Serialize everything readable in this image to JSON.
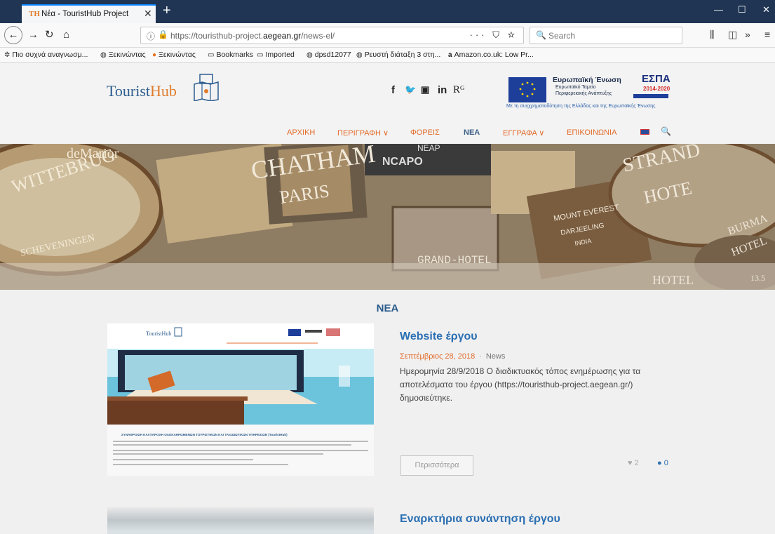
{
  "browser": {
    "tab_title": "Νέα - TouristHub Project",
    "tab_favicon": "TH",
    "url_prefix": "https://touristhub-project.",
    "url_domain": "aegean.gr",
    "url_path": "/news-el/",
    "search_placeholder": "Search"
  },
  "bookmarks": [
    {
      "label": "Πιο συχνά αναγνωσμ...",
      "icon": "gear-icon"
    },
    {
      "label": "Ξεκινώντας",
      "icon": "globe-icon"
    },
    {
      "label": "Ξεκινώντας",
      "icon": "firefox-icon"
    },
    {
      "label": "Bookmarks",
      "icon": "folder-icon"
    },
    {
      "label": "Imported",
      "icon": "folder-icon"
    },
    {
      "label": "dpsd12077",
      "icon": "globe-icon"
    },
    {
      "label": "Ρευστή διάταξη 3 στη...",
      "icon": "globe-icon"
    },
    {
      "label": "Amazon.co.uk: Low Pr...",
      "icon": "amazon-icon"
    }
  ],
  "site": {
    "logo_part1": "Tourist",
    "logo_part2": "Hub",
    "social": [
      "f",
      "🐦",
      "▣",
      "in",
      "Rᴳ"
    ],
    "eu_title": "Ευρωπαϊκή Ένωση",
    "eu_sub1": "Ευρωπαϊκό Ταμείο",
    "eu_sub2": "Περιφερειακής Ανάπτυξης",
    "espa_title": "ΕΣΠΑ",
    "espa_years": "2014-2020",
    "cofund": "Με τη συγχρηματοδότηση της Ελλάδας και της Ευρωπαϊκής Ένωσης"
  },
  "menu": [
    {
      "label": "ΑΡΧΙΚΗ"
    },
    {
      "label": "ΠΕΡΙΓΡΑΦΗ ∨"
    },
    {
      "label": "ΦΟΡΕΙΣ"
    },
    {
      "label": "ΝΕΑ"
    },
    {
      "label": "ΕΓΓΡΑΦΑ ∨"
    },
    {
      "label": "ΕΠΙΚΟΙΝΩΝΙΑ"
    }
  ],
  "hero": {
    "signs": [
      "CHATHAM",
      "PARIS",
      "WITTEBRUG",
      "deMarior",
      "SCHEVENINGEN",
      "GRAND-HOTEL",
      "STRAND",
      "HOTE",
      "MOUNT EVEREST",
      "DARJEELING",
      "INDIA",
      "HOTEL",
      "NCAPO",
      "NEAP",
      "BURMA",
      "HOTEL",
      "13.5"
    ]
  },
  "news": {
    "section_title": "ΝΕΑ",
    "posts": [
      {
        "title": "Website έργου",
        "date": "Σεπτέμβριος 28, 2018",
        "category": "News",
        "excerpt": "Ημερομηνία 28/9/2018 Ο διαδικτυακός τόπος ενημέρωσης για τα αποτελέσματα του έργου (https://touristhub-project.aegean.gr/) δημοσιεύτηκε.",
        "more": "Περισσότερα",
        "likes": "2",
        "comments": "0"
      },
      {
        "title": "Εναρκτήρια συνάντηση έργου"
      }
    ]
  },
  "thumb": {
    "logo": "TouristHub",
    "headline": "ΣΥΝΑΘΡΟΙΣΗ ΚΑΙ ΠΑΡΟΧΗ ΟΛΟΚΛΗΡΩΜΕΝΩΝ ΤΟΥΡΙΣΤΙΚΩΝ ΚΑΙ ΤΑΞΙΔΙΩΤΙΚΩΝ ΥΠΗΡΕΣΙΩΝ (TouristHub)"
  }
}
